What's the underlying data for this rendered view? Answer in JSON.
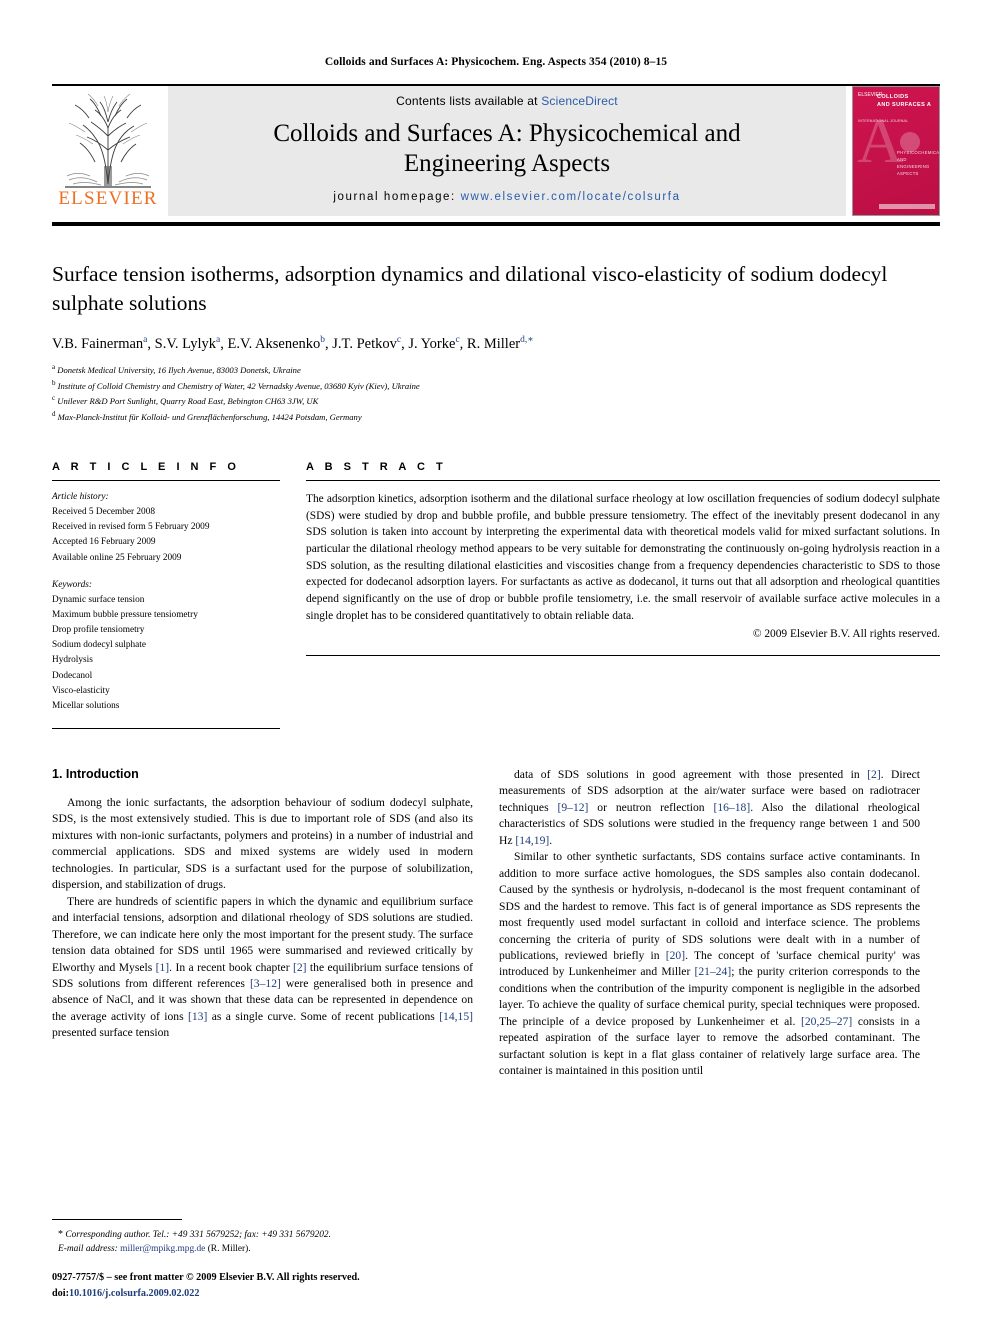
{
  "running_head": "Colloids and Surfaces A: Physicochem. Eng. Aspects 354 (2010) 8–15",
  "masthead": {
    "contents_prefix": "Contents lists available at ",
    "sciencedirect": "ScienceDirect",
    "journal_title_line1": "Colloids and Surfaces A: Physicochemical and",
    "journal_title_line2": "Engineering Aspects",
    "homepage_label": "journal homepage:",
    "homepage_url": "www.elsevier.com/locate/colsurfa",
    "publisher_logo_text": "ELSEVIER",
    "cover": {
      "publisher": "ELSEVIER",
      "title_line1": "COLLOIDS",
      "title_line2": "AND SURFACES A",
      "subtitle_line1": "PHYSICOCHEMICAL",
      "subtitle_line2": "AND ENGINEERING",
      "subtitle_line3": "ASPECTS",
      "corner_label": "INTERNATIONAL JOURNAL",
      "letter": "A"
    }
  },
  "article": {
    "title": "Surface tension isotherms, adsorption dynamics and dilational visco-elasticity of sodium dodecyl sulphate solutions",
    "authors_html": "V.B. Fainerman<sup>a</sup>, S.V. Lylyk<sup>a</sup>, E.V. Aksenenko<sup>b</sup>, J.T. Petkov<sup>c</sup>, J. Yorke<sup>c</sup>, R. Miller<sup>d,<span class=\"star\">∗</span></sup>",
    "affiliations": [
      {
        "mark": "a",
        "text": "Donetsk Medical University, 16 Ilych Avenue, 83003 Donetsk, Ukraine"
      },
      {
        "mark": "b",
        "text": "Institute of Colloid Chemistry and Chemistry of Water, 42 Vernadsky Avenue, 03680 Kyiv (Kiev), Ukraine"
      },
      {
        "mark": "c",
        "text": "Unilever R&D Port Sunlight, Quarry Road East, Bebington CH63 3JW, UK"
      },
      {
        "mark": "d",
        "text": "Max-Planck-Institut für Kolloid- und Grenzflächenforschung, 14424 Potsdam, Germany"
      }
    ]
  },
  "article_info": {
    "heading": "A R T I C L E    I N F O",
    "history_label": "Article history:",
    "history": [
      "Received 5 December 2008",
      "Received in revised form 5 February 2009",
      "Accepted 16 February 2009",
      "Available online 25 February 2009"
    ],
    "keywords_label": "Keywords:",
    "keywords": [
      "Dynamic surface tension",
      "Maximum bubble pressure tensiometry",
      "Drop profile tensiometry",
      "Sodium dodecyl sulphate",
      "Hydrolysis",
      "Dodecanol",
      "Visco-elasticity",
      "Micellar solutions"
    ]
  },
  "abstract": {
    "heading": "A B S T R A C T",
    "text": "The adsorption kinetics, adsorption isotherm and the dilational surface rheology at low oscillation frequencies of sodium dodecyl sulphate (SDS) were studied by drop and bubble profile, and bubble pressure tensiometry. The effect of the inevitably present dodecanol in any SDS solution is taken into account by interpreting the experimental data with theoretical models valid for mixed surfactant solutions. In particular the dilational rheology method appears to be very suitable for demonstrating the continuously on-going hydrolysis reaction in a SDS solution, as the resulting dilational elasticities and viscosities change from a frequency dependencies characteristic to SDS to those expected for dodecanol adsorption layers. For surfactants as active as dodecanol, it turns out that all adsorption and rheological quantities depend significantly on the use of drop or bubble profile tensiometry, i.e. the small reservoir of available surface active molecules in a single droplet has to be considered quantitatively to obtain reliable data.",
    "copyright": "© 2009 Elsevier B.V. All rights reserved."
  },
  "introduction": {
    "section_heading": "1.  Introduction",
    "left_paragraphs": [
      "Among the ionic surfactants, the adsorption behaviour of sodium dodecyl sulphate, SDS, is the most extensively studied. This is due to important role of SDS (and also its mixtures with non-ionic surfactants, polymers and proteins) in a number of industrial and commercial applications. SDS and mixed systems are widely used in modern technologies. In particular, SDS is a surfactant used for the purpose of solubilization, dispersion, and stabilization of drugs.",
      "There are hundreds of scientific papers in which the dynamic and equilibrium surface and interfacial tensions, adsorption and dilational rheology of SDS solutions are studied. Therefore, we can indicate here only the most important for the present study. The surface tension data obtained for SDS until 1965 were summarised and reviewed critically by Elworthy and Mysels [1]. In a recent book chapter [2] the equilibrium surface tensions of SDS solutions from different references [3–12] were generalised both in presence and absence of NaCl, and it was shown that these data can be represented in dependence on the average activity of ions [13] as a single curve. Some of recent publications [14,15] presented surface tension"
    ],
    "right_paragraphs": [
      "data of SDS solutions in good agreement with those presented in [2]. Direct measurements of SDS adsorption at the air/water surface were based on radiotracer techniques [9–12] or neutron reflection [16–18]. Also the dilational rheological characteristics of SDS solutions were studied in the frequency range between 1 and 500 Hz [14,19].",
      "Similar to other synthetic surfactants, SDS contains surface active contaminants. In addition to more surface active homologues, the SDS samples also contain dodecanol. Caused by the synthesis or hydrolysis, n-dodecanol is the most frequent contaminant of SDS and the hardest to remove. This fact is of general importance as SDS represents the most frequently used model surfactant in colloid and interface science. The problems concerning the criteria of purity of SDS solutions were dealt with in a number of publications, reviewed briefly in [20]. The concept of 'surface chemical purity' was introduced by Lunkenheimer and Miller [21–24]; the purity criterion corresponds to the conditions when the contribution of the impurity component is negligible in the adsorbed layer. To achieve the quality of surface chemical purity, special techniques were proposed. The principle of a device proposed by Lunkenheimer et al. [20,25–27] consists in a repeated aspiration of the surface layer to remove the adsorbed contaminant. The surfactant solution is kept in a flat glass container of relatively large surface area. The container is maintained in this position until"
    ]
  },
  "footnotes": {
    "corresponding_author": "Corresponding author. Tel.: +49 331 5679252; fax: +49 331 5679202.",
    "email_label": "E-mail address:",
    "email": "miller@mpikg.mpg.de",
    "email_attribution": "(R. Miller)."
  },
  "imprint": {
    "issn_line": "0927-7757/$ – see front matter © 2009 Elsevier B.V. All rights reserved.",
    "doi_label": "doi:",
    "doi": "10.1016/j.colsurfa.2009.02.022"
  },
  "colors": {
    "link_blue": "#2a5caa",
    "ref_blue": "#1f3d7a",
    "elsevier_orange": "#ef6f22",
    "cover_red": "#c8104a"
  }
}
